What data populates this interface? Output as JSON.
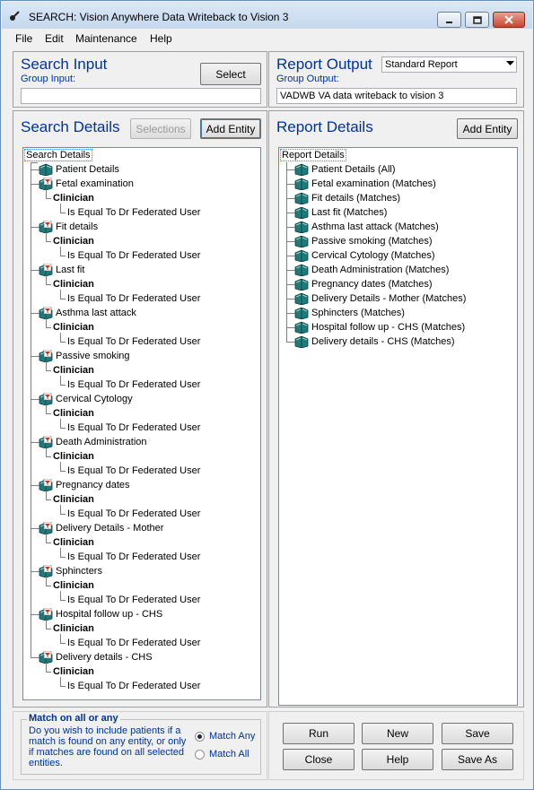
{
  "window": {
    "title": "SEARCH: Vision Anywhere Data Writeback to Vision 3",
    "controls": {
      "minimize_icon": "minimize-icon",
      "maximize_icon": "maximize-icon",
      "close_icon": "close-icon"
    }
  },
  "menu": [
    "File",
    "Edit",
    "Maintenance",
    "Help"
  ],
  "search_input": {
    "heading": "Search Input",
    "group_label": "Group Input:",
    "group_value": "",
    "select_button": "Select"
  },
  "report_output": {
    "heading": "Report Output",
    "dropdown_value": "Standard Report",
    "group_label": "Group Output:",
    "group_value": "VADWB VA data writeback to vision 3"
  },
  "search_details": {
    "heading": "Search Details",
    "selections_button": "Selections",
    "add_entity_button": "Add Entity",
    "root": "Search Details",
    "entities": [
      {
        "name": "Patient Details",
        "icon": "book-icon"
      },
      {
        "name": "Fetal examination",
        "icon": "filter-book-icon",
        "field": "Clinician",
        "condition": "Is Equal To Dr Federated User"
      },
      {
        "name": "Fit details",
        "icon": "filter-book-icon",
        "field": "Clinician",
        "condition": "Is Equal To Dr Federated User"
      },
      {
        "name": "Last fit",
        "icon": "filter-book-icon",
        "field": "Clinician",
        "condition": "Is Equal To Dr Federated User"
      },
      {
        "name": "Asthma last attack",
        "icon": "filter-book-icon",
        "field": "Clinician",
        "condition": "Is Equal To Dr Federated User"
      },
      {
        "name": "Passive smoking",
        "icon": "filter-book-icon",
        "field": "Clinician",
        "condition": "Is Equal To Dr Federated User"
      },
      {
        "name": "Cervical Cytology",
        "icon": "filter-book-icon",
        "field": "Clinician",
        "condition": "Is Equal To Dr Federated User"
      },
      {
        "name": "Death Administration",
        "icon": "filter-book-icon",
        "field": "Clinician",
        "condition": "Is Equal To Dr Federated User"
      },
      {
        "name": "Pregnancy dates",
        "icon": "filter-book-icon",
        "field": "Clinician",
        "condition": "Is Equal To Dr Federated User"
      },
      {
        "name": "Delivery Details - Mother",
        "icon": "filter-book-icon",
        "field": "Clinician",
        "condition": "Is Equal To Dr Federated User"
      },
      {
        "name": "Sphincters",
        "icon": "filter-book-icon",
        "field": "Clinician",
        "condition": "Is Equal To Dr Federated User"
      },
      {
        "name": "Hospital follow up - CHS",
        "icon": "filter-book-icon",
        "field": "Clinician",
        "condition": "Is Equal To Dr Federated User"
      },
      {
        "name": "Delivery details - CHS",
        "icon": "filter-book-icon",
        "field": "Clinician",
        "condition": "Is Equal To Dr Federated User"
      }
    ]
  },
  "report_details": {
    "heading": "Report Details",
    "add_entity_button": "Add Entity",
    "root": "Report Details",
    "entities": [
      "Patient Details (All)",
      "Fetal examination (Matches)",
      "Fit details (Matches)",
      "Last fit (Matches)",
      "Asthma last attack (Matches)",
      "Passive smoking (Matches)",
      "Cervical Cytology (Matches)",
      "Death Administration (Matches)",
      "Pregnancy dates (Matches)",
      "Delivery Details - Mother (Matches)",
      "Sphincters (Matches)",
      "Hospital follow up - CHS (Matches)",
      "Delivery details - CHS (Matches)"
    ]
  },
  "match": {
    "title": "Match on all or any",
    "description": "Do you wish to include patients if a match is found on any entity, or only if matches are found on all selected entities.",
    "options": [
      {
        "label": "Match Any",
        "selected": true
      },
      {
        "label": "Match All",
        "selected": false
      }
    ]
  },
  "actions": {
    "run": "Run",
    "new": "New",
    "save": "Save",
    "close": "Close",
    "help": "Help",
    "save_as": "Save As"
  },
  "colors": {
    "heading": "#003399",
    "title_bar": "#c5d8ee",
    "book": "#1f7a7a",
    "filter_badge": "#c0392b"
  }
}
